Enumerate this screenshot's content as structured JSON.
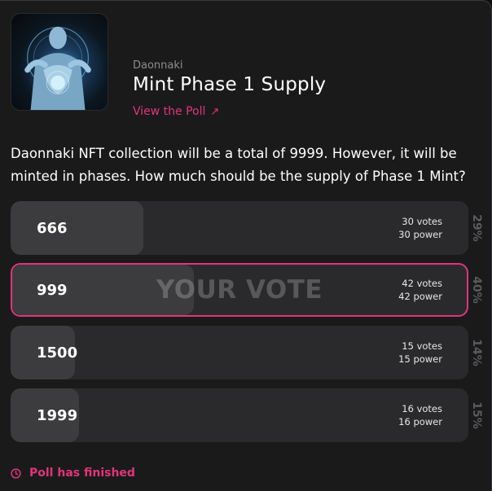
{
  "poll": {
    "group": "Daonnaki",
    "title": "Mint Phase 1 Supply",
    "view_link": "View the Poll",
    "question": "Daonnaki NFT collection will be a total of 9999. However, it will be minted in phases. How much should be the supply of Phase 1 Mint?",
    "your_vote_label": "YOUR VOTE",
    "status": "Poll has finished",
    "accent_color": "#e0357a",
    "options": [
      {
        "label": "666",
        "votes": "30 votes",
        "power": "30 power",
        "percent": "29%",
        "share": 0.29,
        "voted": false
      },
      {
        "label": "999",
        "votes": "42 votes",
        "power": "42 power",
        "percent": "40%",
        "share": 0.4,
        "voted": true
      },
      {
        "label": "1500",
        "votes": "15 votes",
        "power": "15 power",
        "percent": "14%",
        "share": 0.14,
        "voted": false
      },
      {
        "label": "1999",
        "votes": "16 votes",
        "power": "16 power",
        "percent": "15%",
        "share": 0.15,
        "voted": false
      }
    ]
  }
}
